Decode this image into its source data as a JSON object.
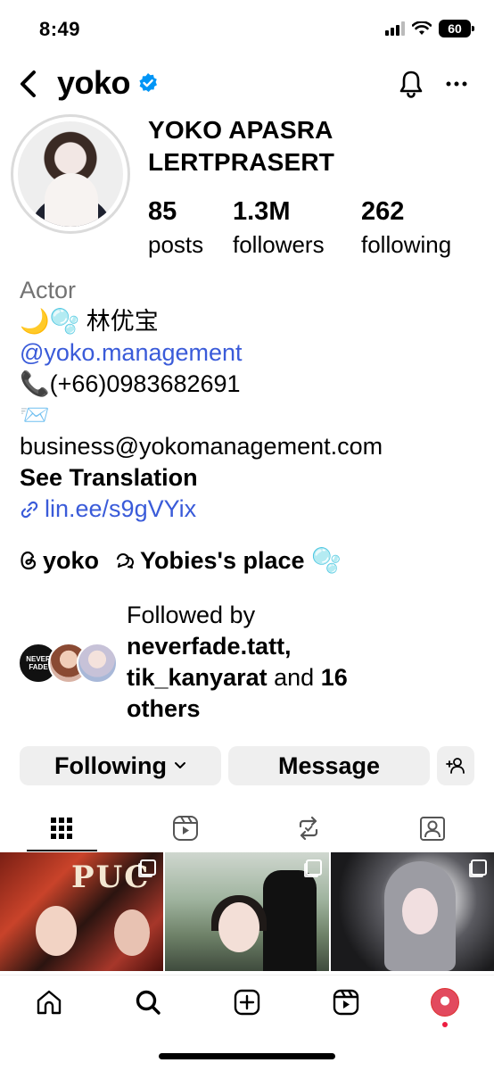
{
  "status_bar": {
    "time": "8:49",
    "battery": "60"
  },
  "header": {
    "username": "yoko"
  },
  "profile": {
    "full_name": "YOKO APASRA LERTPRASERT",
    "stats": [
      {
        "value": "85",
        "label": "posts"
      },
      {
        "value": "1.3M",
        "label": "followers"
      },
      {
        "value": "262",
        "label": "following"
      }
    ]
  },
  "bio": {
    "category": "Actor",
    "line1": "🌙🫧 林优宝",
    "mention": "@yoko.management",
    "phone": "📞(+66)0983682691",
    "email_emoji": "📨",
    "email": "business@yokomanagement.com",
    "see_translation": "See Translation",
    "link": "lin.ee/s9gVYix"
  },
  "threads": {
    "threads_name": "yoko",
    "channel_name": "Yobies's place 🫧"
  },
  "followed_by": {
    "prefix": "Followed by",
    "user1": "neverfade.tatt,",
    "user2": "tik_kanyarat",
    "and": "and",
    "count": "16",
    "others": "others",
    "avatar1_text": "NEVER FADE"
  },
  "buttons": {
    "following": "Following",
    "message": "Message"
  },
  "grid_posts": [
    {
      "overlay_text": "PUC"
    },
    {
      "overlay_text": ""
    },
    {
      "overlay_text": ""
    }
  ],
  "colors": {
    "link": "#3a5bd9",
    "verified": "#0095f6",
    "button_bg": "#efefef",
    "notification_dot": "#ed1c40"
  }
}
